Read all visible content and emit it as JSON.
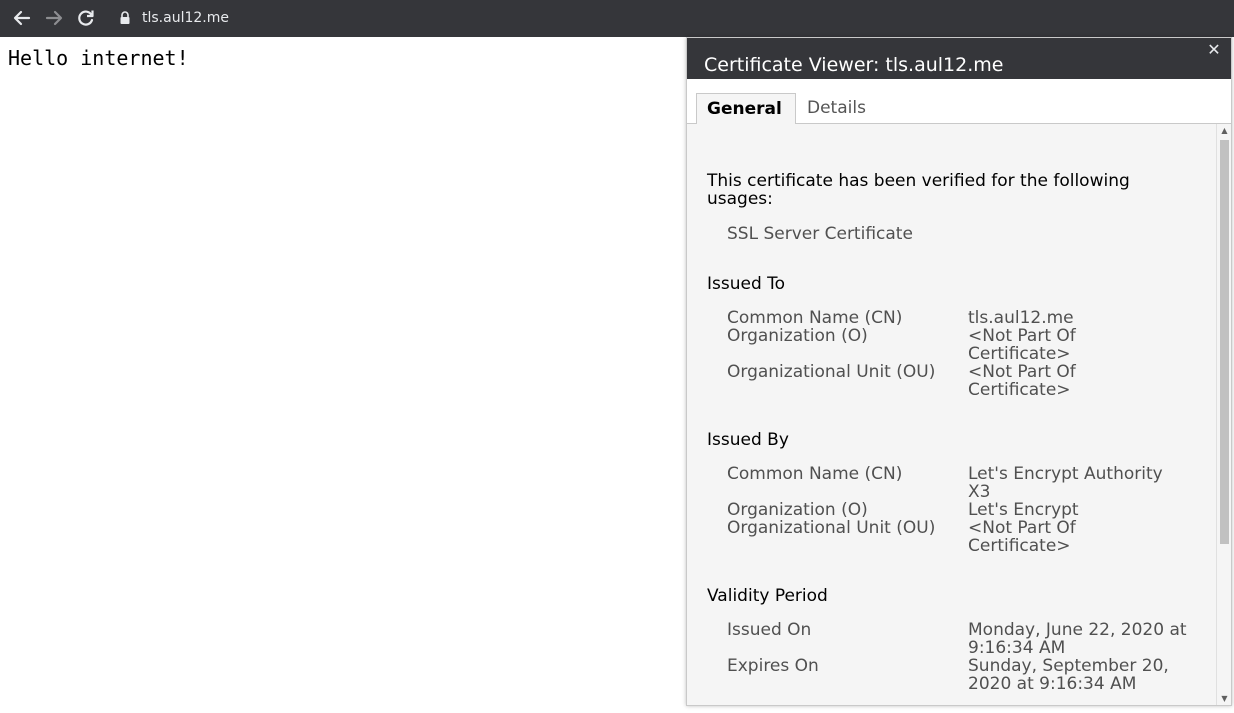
{
  "browser": {
    "url": "tls.aul12.me",
    "icons": [
      "back-arrow-icon",
      "forward-arrow-icon",
      "reload-icon",
      "lock-icon"
    ]
  },
  "page": {
    "text": "Hello internet!"
  },
  "dialog": {
    "title": "Certificate Viewer: tls.aul12.me",
    "close_icon": "close-icon",
    "tabs": [
      {
        "label": "General",
        "active": true
      },
      {
        "label": "Details",
        "active": false
      }
    ],
    "usages_intro": "This certificate has been verified for the following usages:",
    "usage_item": "SSL Server Certificate",
    "issued_to": {
      "title": "Issued To",
      "rows": [
        {
          "label": "Common Name (CN)",
          "value": "tls.aul12.me"
        },
        {
          "label": "Organization (O)",
          "value": "<Not Part Of Certificate>"
        },
        {
          "label": "Organizational Unit (OU)",
          "value": "<Not Part Of Certificate>"
        }
      ]
    },
    "issued_by": {
      "title": "Issued By",
      "rows": [
        {
          "label": "Common Name (CN)",
          "value": "Let's Encrypt Authority X3"
        },
        {
          "label": "Organization (O)",
          "value": "Let's Encrypt"
        },
        {
          "label": "Organizational Unit (OU)",
          "value": "<Not Part Of Certificate>"
        }
      ]
    },
    "validity": {
      "title": "Validity Period",
      "rows": [
        {
          "label": "Issued On",
          "value": "Monday, June 22, 2020 at 9:16:34 AM"
        },
        {
          "label": "Expires On",
          "value": "Sunday, September 20, 2020 at 9:16:34 AM"
        }
      ]
    }
  },
  "colors": {
    "topbar": "#35363a",
    "dialog_header": "#35363a",
    "content_bg": "#f5f5f5",
    "label_text": "#505050"
  }
}
